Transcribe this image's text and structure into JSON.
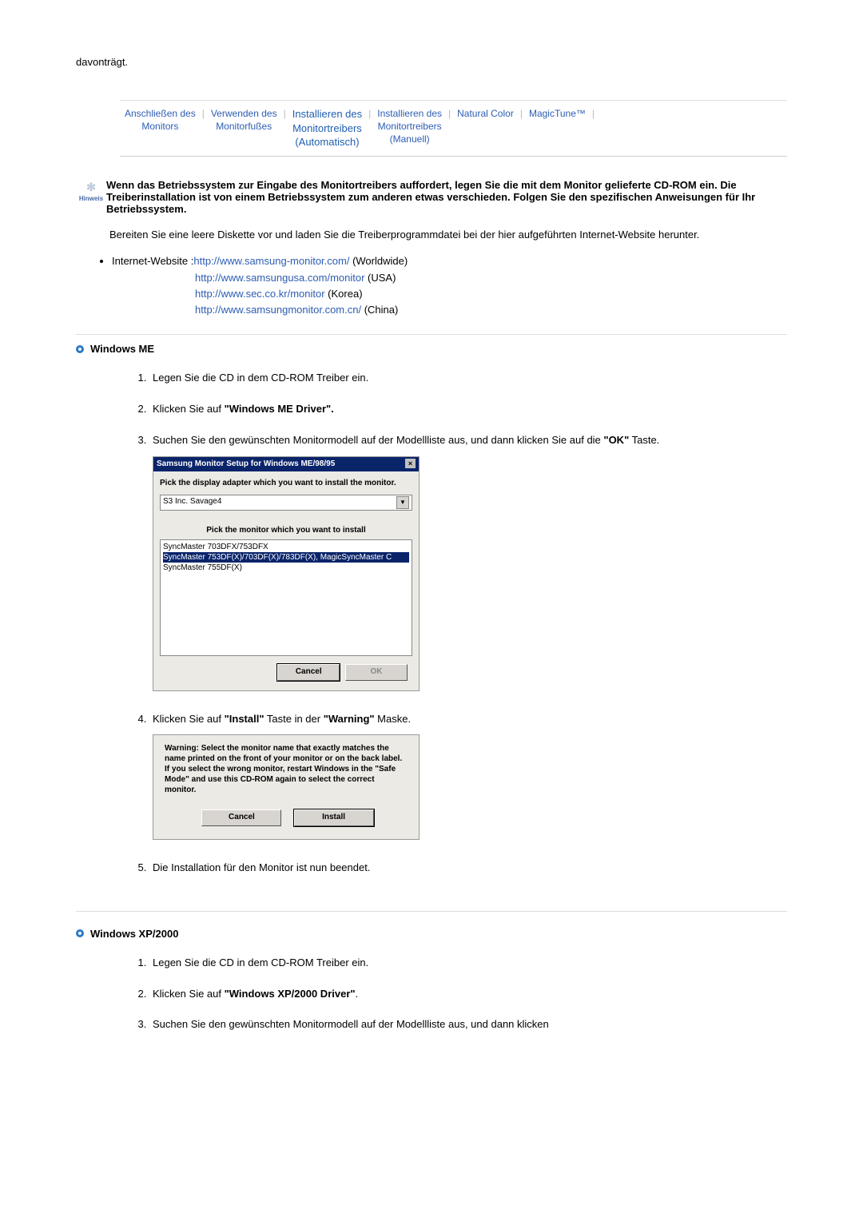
{
  "top_text": "davonträgt.",
  "tabs": {
    "t1_l1": "Anschließen des",
    "t1_l2": "Monitors",
    "t2_l1": "Verwenden des",
    "t2_l2": "Monitorfußes",
    "t3_l1": "Installieren des",
    "t3_l2": "Monitortreibers",
    "t3_l3": "(Automatisch)",
    "t4_l1": "Installieren des",
    "t4_l2": "Monitortreibers",
    "t4_l3": "(Manuell)",
    "t5": "Natural Color",
    "t6": "MagicTune™"
  },
  "hinweis_label": "Hinweis",
  "hinweis_text": "Wenn das Betriebssystem zur Eingabe des Monitortreibers auffordert, legen Sie die mit dem Monitor gelieferte CD-ROM ein. Die Treiberinstallation ist von einem Betriebssystem zum anderen etwas verschieden. Folgen Sie den spezifischen Anweisungen für Ihr Betriebssystem.",
  "prepare_text": "Bereiten Sie eine leere Diskette vor und laden Sie die Treiberprogrammdatei bei der hier aufgeführten Internet-Website herunter.",
  "site_label": "Internet-Website :",
  "sites": {
    "s1_url": "http://www.samsung-monitor.com/",
    "s1_suffix": " (Worldwide)",
    "s2_url": "http://www.samsungusa.com/monitor",
    "s2_suffix": " (USA)",
    "s3_url": "http://www.sec.co.kr/monitor",
    "s3_suffix": " (Korea)",
    "s4_url": "http://www.samsungmonitor.com.cn/",
    "s4_suffix": " (China)"
  },
  "section_me": "Windows ME",
  "me_steps": {
    "s1": "Legen Sie die CD in dem CD-ROM Treiber ein.",
    "s2_pre": "Klicken Sie auf ",
    "s2_bold": "\"Windows ME Driver\".",
    "s3_pre": "Suchen Sie den gewünschten Monitormodell auf der Modellliste aus, und dann klicken Sie auf die ",
    "s3_bold": "\"OK\"",
    "s3_post": " Taste.",
    "s4_pre": "Klicken Sie auf ",
    "s4_bold1": "\"Install\"",
    "s4_mid": " Taste in der ",
    "s4_bold2": "\"Warning\"",
    "s4_post": " Maske.",
    "s5": "Die Installation für den Monitor ist nun beendet."
  },
  "dialog1": {
    "title": "Samsung Monitor Setup for Windows  ME/98/95",
    "lbl1": "Pick the display adapter which you want to install the monitor.",
    "adapter": "S3 Inc. Savage4",
    "lbl2": "Pick the monitor which you want to install",
    "row1": "SyncMaster 703DFX/753DFX",
    "row2": "SyncMaster 753DF(X)/703DF(X)/783DF(X), MagicSyncMaster C",
    "row3": "SyncMaster 755DF(X)",
    "btn_cancel": "Cancel",
    "btn_ok": "OK"
  },
  "dialog2": {
    "text": "Warning: Select the monitor name that exactly matches the name printed on the front of your monitor or on the back label. If you select the wrong monitor, restart Windows in the \"Safe Mode\" and use this CD-ROM again to select the correct monitor.",
    "btn_cancel": "Cancel",
    "btn_install": "Install"
  },
  "section_xp": "Windows XP/2000",
  "xp_steps": {
    "s1": "Legen Sie die CD in dem CD-ROM Treiber ein.",
    "s2_pre": "Klicken Sie auf ",
    "s2_bold": "\"Windows XP/2000 Driver\"",
    "s2_post": ".",
    "s3": "Suchen Sie den gewünschten Monitormodell auf der Modellliste aus, und dann klicken"
  }
}
